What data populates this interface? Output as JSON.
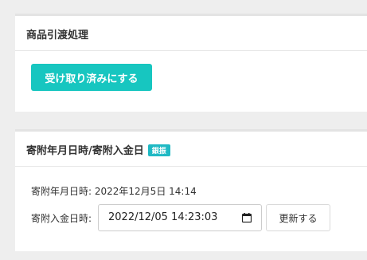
{
  "handover_panel": {
    "title": "商品引渡処理",
    "received_button_label": "受け取り済みにする"
  },
  "donation_panel": {
    "title": "寄附年月日時/寄附入金日",
    "badge": "銀振",
    "donation_datetime_label": "寄附年月日時:",
    "donation_datetime_value": "2022年12月5日 14:14",
    "payment_date_label": "寄附入金日時:",
    "payment_date_value": "2022/12/05 14:23:03",
    "update_button_label": "更新する"
  },
  "colors": {
    "accent": "#17c6c0",
    "badge": "#1fb9c4",
    "page_background": "#eeeeee"
  },
  "icons": {
    "date_picker": "calendar-icon"
  }
}
